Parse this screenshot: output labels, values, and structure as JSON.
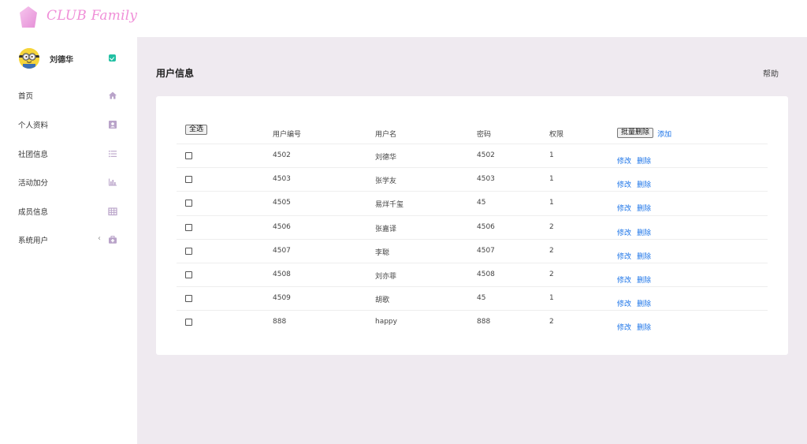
{
  "brand": "CLUB Family",
  "user": {
    "name": "刘德华"
  },
  "sidebar": {
    "items": [
      {
        "label": "首页",
        "icon": "home-icon"
      },
      {
        "label": "个人资料",
        "icon": "profile-card-icon"
      },
      {
        "label": "社团信息",
        "icon": "list-icon"
      },
      {
        "label": "活动加分",
        "icon": "bar-chart-icon"
      },
      {
        "label": "成员信息",
        "icon": "table-icon"
      },
      {
        "label": "系统用户",
        "icon": "medkit-icon"
      }
    ]
  },
  "main": {
    "title": "用户信息",
    "help": "帮助"
  },
  "table": {
    "select_all": "全选",
    "headers": [
      "用户编号",
      "用户名",
      "密码",
      "权限"
    ],
    "batch_delete": "批量删除",
    "add": "添加",
    "edit": "修改",
    "delete": "删除",
    "rows": [
      [
        "4502",
        "刘德华",
        "4502",
        "1"
      ],
      [
        "4503",
        "张学友",
        "4503",
        "1"
      ],
      [
        "4505",
        "易烊千玺",
        "45",
        "1"
      ],
      [
        "4506",
        "张嘉译",
        "4506",
        "2"
      ],
      [
        "4507",
        "李聪",
        "4507",
        "2"
      ],
      [
        "4508",
        "刘亦菲",
        "4508",
        "2"
      ],
      [
        "4509",
        "胡歌",
        "45",
        "1"
      ],
      [
        "888",
        "happy",
        "888",
        "2"
      ]
    ]
  },
  "colors": {
    "accent": "#f08fd8",
    "link": "#1a73e8",
    "icon": "#b9a3c9",
    "verify": "#22c0a3",
    "background": "#efeaf0"
  }
}
